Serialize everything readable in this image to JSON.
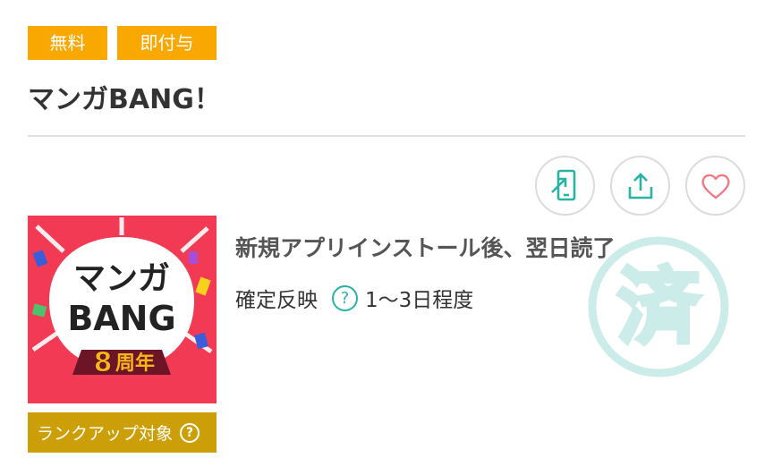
{
  "tags": {
    "free": "無料",
    "instant": "即付与"
  },
  "title": "マンガBANG！",
  "actions": {
    "send_to_phone_icon": "phone-send-icon",
    "share_icon": "share-icon",
    "favorite_icon": "heart-icon"
  },
  "thumbnail": {
    "line1": "マンガ",
    "line2": "BANG",
    "anniversary_num": "8",
    "anniversary_text": "周年"
  },
  "rank_badge": {
    "label": "ランクアップ対象",
    "help": "?"
  },
  "condition": "新規アプリインストール後、翌日読了",
  "timing": {
    "label": "確定反映",
    "help": "?",
    "value": "1〜3日程度"
  },
  "stamp": {
    "text": "済"
  },
  "colors": {
    "tag": "#f8a800",
    "accent": "#29b3a5",
    "rank_badge": "#cc9f08",
    "heart": "#f07a85"
  }
}
